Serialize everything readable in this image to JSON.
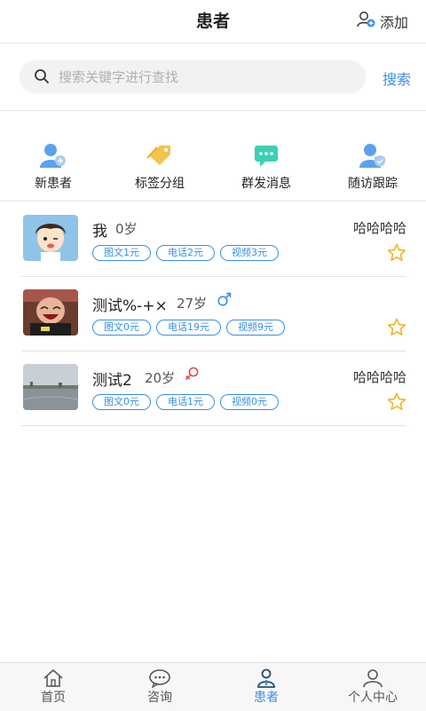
{
  "header": {
    "title": "患者",
    "add_label": "添加"
  },
  "search": {
    "placeholder": "搜索关键字进行查找",
    "value": "",
    "button_label": "搜索"
  },
  "shortcuts": [
    {
      "label": "新患者",
      "icon": "new-patient-icon"
    },
    {
      "label": "标签分组",
      "icon": "tag-icon"
    },
    {
      "label": "群发消息",
      "icon": "message-icon"
    },
    {
      "label": "随访跟踪",
      "icon": "follow-up-icon"
    }
  ],
  "patients": [
    {
      "name": "我",
      "age": "0岁",
      "gender": "",
      "remark": "哈哈哈哈",
      "services": [
        "图文1元",
        "电话2元",
        "视频3元"
      ],
      "avatar": "cartoon-boy-avatar"
    },
    {
      "name": "测试%-+×",
      "age": "27岁",
      "gender": "male",
      "remark": "",
      "services": [
        "图文0元",
        "电话19元",
        "视频9元"
      ],
      "avatar": "laughing-kid-avatar"
    },
    {
      "name": "测试2",
      "age": "20岁",
      "gender": "female",
      "remark": "哈哈哈哈",
      "services": [
        "图文0元",
        "电话1元",
        "视频0元"
      ],
      "avatar": "lake-photo-avatar"
    }
  ],
  "bottom_nav": [
    {
      "label": "首页",
      "icon": "home-icon",
      "active": false
    },
    {
      "label": "咨询",
      "icon": "chat-icon",
      "active": false
    },
    {
      "label": "患者",
      "icon": "patient-icon",
      "active": true
    },
    {
      "label": "个人中心",
      "icon": "profile-icon",
      "active": false
    }
  ],
  "colors": {
    "accent": "#3a8ee6",
    "star": "#f0b429",
    "male": "#3a8ee6",
    "female": "#e84a4a"
  }
}
